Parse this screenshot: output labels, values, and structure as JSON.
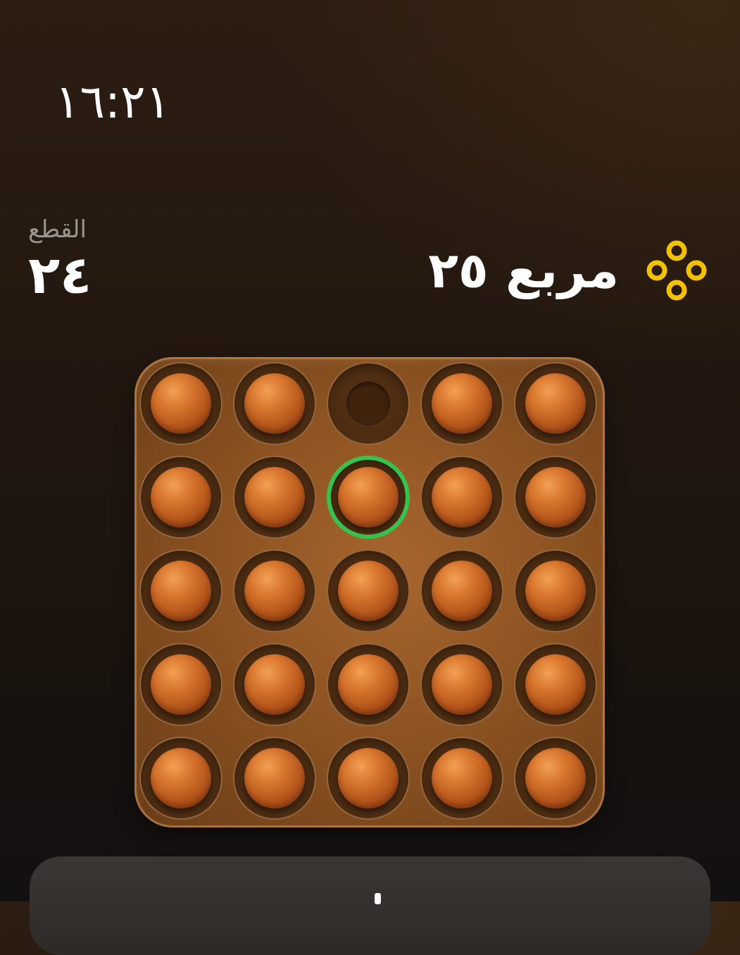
{
  "status_bar": {
    "time": "١٦:٢١"
  },
  "stats": {
    "pieces_label": "القطع",
    "pieces_count": "٢٤"
  },
  "level": {
    "title": "مربع ٢٥",
    "icon": "four-circles-icon",
    "icon_color": "#f2c200"
  },
  "board": {
    "rows": 5,
    "cols": 5,
    "cells": [
      [
        "peg",
        "peg",
        "empty",
        "peg",
        "peg"
      ],
      [
        "peg",
        "peg",
        "peg",
        "peg",
        "peg"
      ],
      [
        "peg",
        "peg",
        "peg",
        "peg",
        "peg"
      ],
      [
        "peg",
        "peg",
        "peg",
        "peg",
        "peg"
      ],
      [
        "peg",
        "peg",
        "peg",
        "peg",
        "peg"
      ]
    ],
    "selected": {
      "row": 2,
      "col": 3
    },
    "selection_color": "#37c24d",
    "peg_color": "#d9772f",
    "board_color": "#8d5322"
  }
}
